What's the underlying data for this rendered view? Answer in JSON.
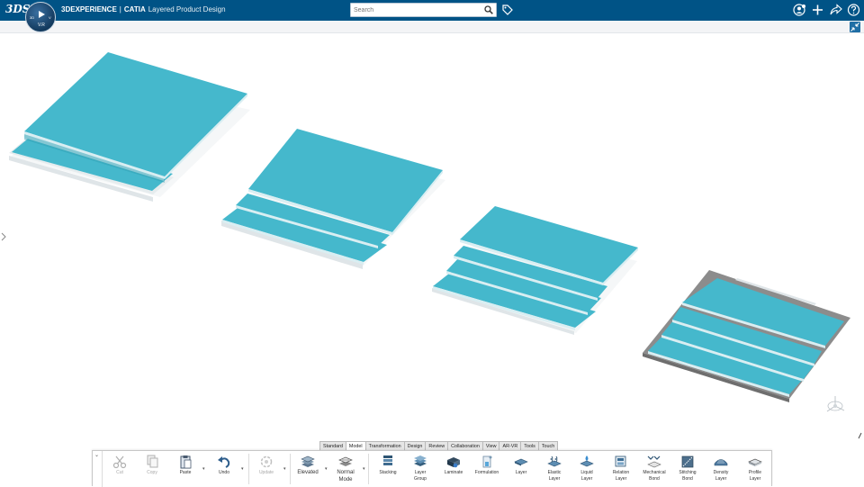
{
  "header": {
    "brand": "3DEXPERIENCE",
    "separator": "|",
    "app_name": "CATIA",
    "app_subtitle": "Layered Product Design",
    "compass": {
      "version": "V.R",
      "left_tag": "3D",
      "right_tag": "V"
    }
  },
  "search": {
    "placeholder": "Search",
    "value": ""
  },
  "icons": {
    "logo": "3ds-logo-icon",
    "search": "search-icon",
    "tags": "tag-icon",
    "user": "user-profile-icon",
    "add": "plus-icon",
    "share": "share-icon",
    "help": "help-icon",
    "fullscreen": "collapse-arrows-icon",
    "axis": "axis-triad-icon"
  },
  "colors": {
    "header_bg": "#005386",
    "layer_face": "#45b8cc",
    "layer_edge": "#d9eef2",
    "selected_frame": "#8c8c8c"
  },
  "tabs": [
    {
      "label": "Standard",
      "active": false
    },
    {
      "label": "Model",
      "active": true
    },
    {
      "label": "Transformation",
      "active": false
    },
    {
      "label": "Design",
      "active": false
    },
    {
      "label": "Review",
      "active": false
    },
    {
      "label": "Collaboration",
      "active": false
    },
    {
      "label": "View",
      "active": false
    },
    {
      "label": "AR-VR",
      "active": false
    },
    {
      "label": "Tools",
      "active": false
    },
    {
      "label": "Touch",
      "active": false
    }
  ],
  "toolbar": {
    "cut": "Cut",
    "copy": "Copy",
    "paste": "Paste",
    "undo": "Undo",
    "update": "Update",
    "elevated": "Elevated",
    "normal_mode_1": "Normal",
    "normal_mode_2": "Mode",
    "stacking": "Stacking",
    "layer_group_1": "Layer",
    "layer_group_2": "Group",
    "laminate": "Laminate",
    "formulation": "Formulation",
    "layer": "Layer",
    "elastic_1": "Elastic",
    "elastic_2": "Layer",
    "liquid_1": "Liquid",
    "liquid_2": "Layer",
    "relation_1": "Relation",
    "relation_2": "Layer",
    "mechanical_1": "Mechanical",
    "mechanical_2": "Bond",
    "stitching_1": "Stitching",
    "stitching_2": "Bond",
    "density_1": "Density",
    "density_2": "Layer",
    "profile_1": "Profile",
    "profile_2": "Layer"
  }
}
